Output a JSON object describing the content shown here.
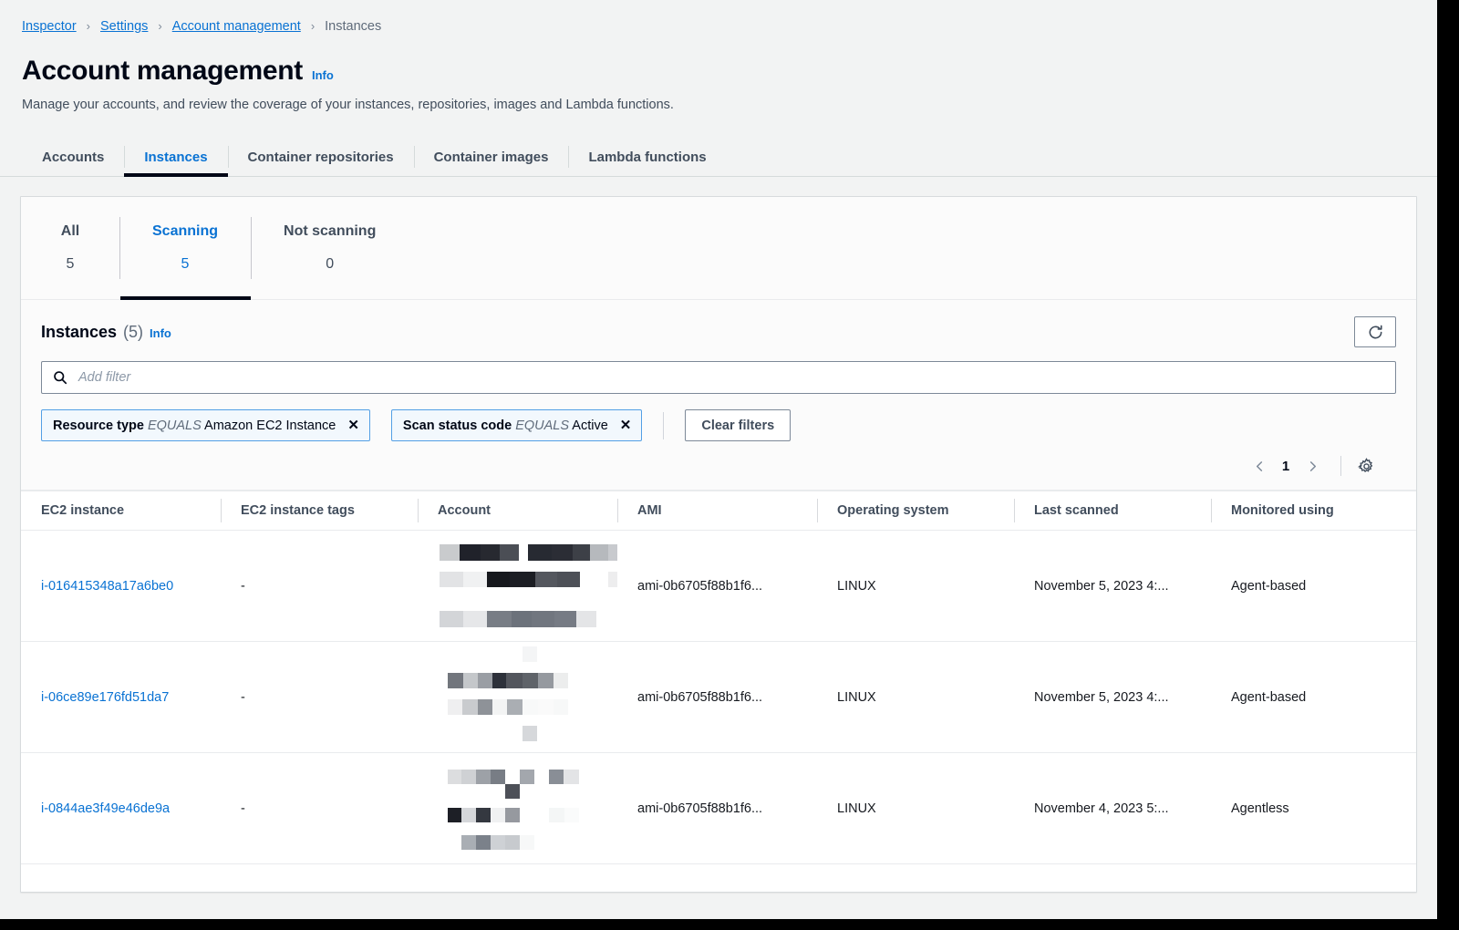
{
  "breadcrumb": {
    "separator": "›",
    "items": [
      {
        "label": "Inspector",
        "current": false
      },
      {
        "label": "Settings",
        "current": false
      },
      {
        "label": "Account management",
        "current": false
      },
      {
        "label": "Instances",
        "current": true
      }
    ]
  },
  "header": {
    "title": "Account management",
    "info_label": "Info",
    "description": "Manage your accounts, and review the coverage of your instances, repositories, images and Lambda functions."
  },
  "tabs": [
    {
      "label": "Accounts",
      "active": false
    },
    {
      "label": "Instances",
      "active": true
    },
    {
      "label": "Container repositories",
      "active": false
    },
    {
      "label": "Container images",
      "active": false
    },
    {
      "label": "Lambda functions",
      "active": false
    }
  ],
  "segments": [
    {
      "label": "All",
      "value": "5",
      "active": false
    },
    {
      "label": "Scanning",
      "value": "5",
      "active": true
    },
    {
      "label": "Not scanning",
      "value": "0",
      "active": false
    }
  ],
  "table_header": {
    "title": "Instances",
    "count": "(5)",
    "info_label": "Info",
    "refresh_icon": "refresh-icon"
  },
  "search": {
    "icon": "search-icon",
    "placeholder": "Add filter",
    "value": ""
  },
  "filters": {
    "tokens": [
      {
        "property": "Resource type",
        "operator": "EQUALS",
        "value": "Amazon EC2 Instance",
        "remove_icon": "close-icon"
      },
      {
        "property": "Scan status code",
        "operator": "EQUALS",
        "value": "Active",
        "remove_icon": "close-icon"
      }
    ],
    "clear_label": "Clear filters"
  },
  "pagination": {
    "prev_icon": "chevron-left-icon",
    "page": "1",
    "next_icon": "chevron-right-icon",
    "settings_icon": "gear-icon"
  },
  "grid": {
    "columns": [
      "EC2 instance",
      "EC2 instance tags",
      "Account",
      "AMI",
      "Operating system",
      "Last scanned",
      "Monitored using"
    ],
    "rows": [
      {
        "instance": "i-016415348a17a6be0",
        "tags": "-",
        "account": "",
        "ami": "ami-0b6705f88b1f6...",
        "os": "LINUX",
        "last_scanned": "November 5, 2023 4:...",
        "monitored_using": "Agent-based"
      },
      {
        "instance": "i-06ce89e176fd51da7",
        "tags": "-",
        "account": "",
        "ami": "ami-0b6705f88b1f6...",
        "os": "LINUX",
        "last_scanned": "November 5, 2023 4:...",
        "monitored_using": "Agent-based"
      },
      {
        "instance": "i-0844ae3f49e46de9a",
        "tags": "-",
        "account": "",
        "ami": "ami-0b6705f88b1f6...",
        "os": "LINUX",
        "last_scanned": "November 4, 2023 5:...",
        "monitored_using": "Agentless"
      }
    ]
  },
  "colors": {
    "link": "#0972d3",
    "page_background": "#f2f3f3",
    "card_background": "#ffffff",
    "active_tab_underline": "#000716",
    "token_border": "#539fe5",
    "token_background": "#f2f8fd"
  }
}
